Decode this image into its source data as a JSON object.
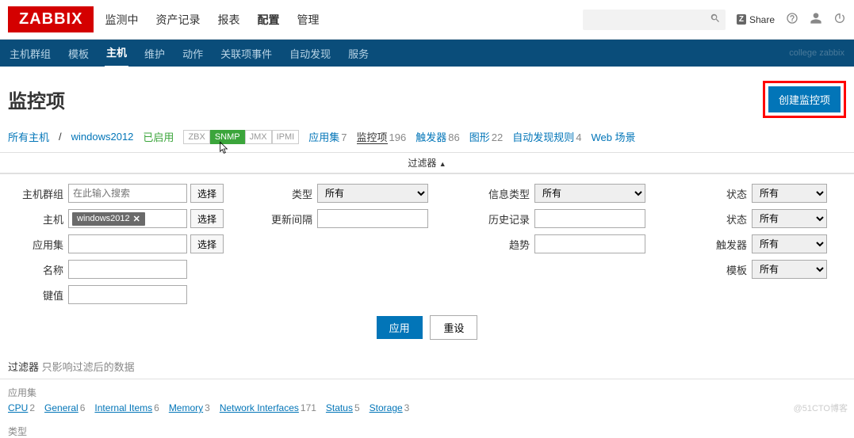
{
  "header": {
    "logo": "ZABBIX",
    "nav": {
      "monitoring": "监测中",
      "inventory": "资产记录",
      "reports": "报表",
      "config": "配置",
      "admin": "管理"
    },
    "share": "Share"
  },
  "subnav": {
    "hostgroups": "主机群组",
    "templates": "模板",
    "hosts": "主机",
    "maintenance": "维护",
    "actions": "动作",
    "correlation": "关联项事件",
    "discovery": "自动发现",
    "services": "服务",
    "user": "college zabbix"
  },
  "page": {
    "title": "监控项",
    "create_btn": "创建监控项"
  },
  "crumb": {
    "all_hosts": "所有主机",
    "host": "windows2012",
    "enabled": "已启用",
    "tags": {
      "zbx": "ZBX",
      "snmp": "SNMP",
      "jmx": "JMX",
      "ipmi": "IPMI"
    },
    "tabs": {
      "apps": {
        "label": "应用集",
        "count": 7
      },
      "items": {
        "label": "监控项",
        "count": 196
      },
      "triggers": {
        "label": "触发器",
        "count": 86
      },
      "graphs": {
        "label": "图形",
        "count": 22
      },
      "discovery": {
        "label": "自动发现规则",
        "count": 4
      },
      "web": {
        "label": "Web 场景",
        "count": ""
      }
    }
  },
  "filter": {
    "toggle": "过滤器",
    "labels": {
      "hostgroup": "主机群组",
      "host": "主机",
      "app": "应用集",
      "name": "名称",
      "key": "键值",
      "type": "类型",
      "interval": "更新间隔",
      "infotype": "信息类型",
      "history": "历史记录",
      "trend": "趋势",
      "state": "状态",
      "status": "状态",
      "trigger": "触发器",
      "template": "模板"
    },
    "select_btn": "选择",
    "placeholder_hostgroup": "在此输入搜索",
    "host_tag": "windows2012",
    "opt_all": "所有",
    "apply": "应用",
    "reset": "重设",
    "note_label": "过滤器",
    "note_text": "只影响过滤后的数据"
  },
  "subfilter": {
    "apps_label": "应用集",
    "apps": [
      {
        "name": "CPU",
        "count": 2
      },
      {
        "name": "General",
        "count": 6
      },
      {
        "name": "Internal Items",
        "count": 6
      },
      {
        "name": "Memory",
        "count": 3
      },
      {
        "name": "Network Interfaces",
        "count": 171
      },
      {
        "name": "Status",
        "count": 5
      },
      {
        "name": "Storage",
        "count": 3
      }
    ],
    "type_label": "类型"
  },
  "watermark": "@51CTO博客"
}
